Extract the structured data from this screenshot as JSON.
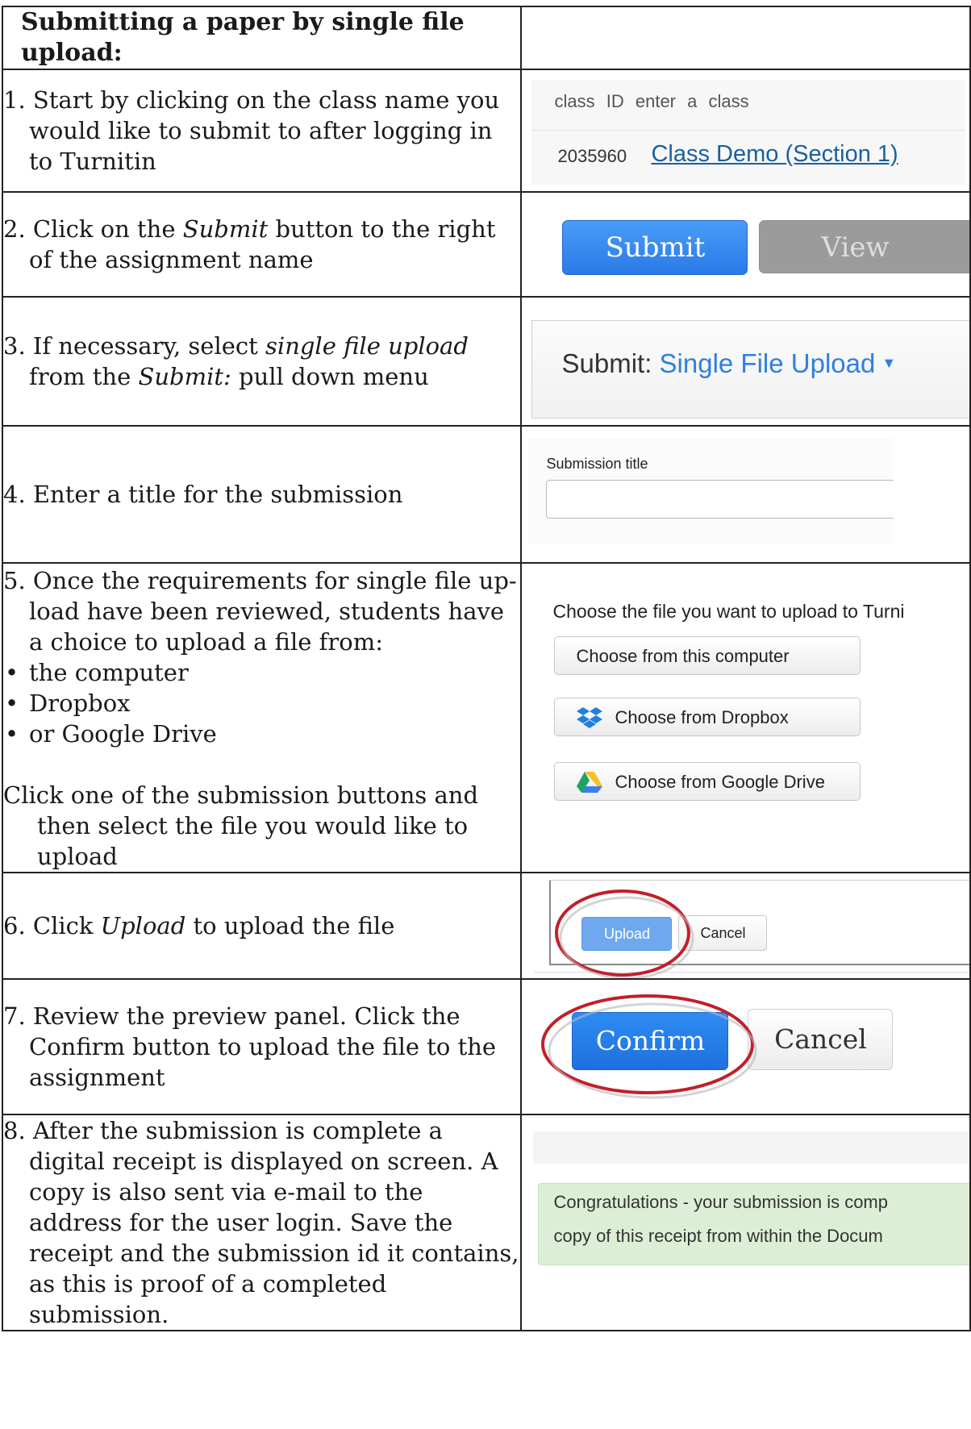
{
  "header": {
    "title": "Submitting a paper by single file upload:"
  },
  "steps": [
    {
      "num": "1.",
      "text": "Start by clicking on the class name you would like to submit to after logging in to Turnitin"
    },
    {
      "num": "2.",
      "pre": "Click on the ",
      "em": "Submit",
      "post": " button to the right of the assignment name"
    },
    {
      "num": "3.",
      "pre": "If necessary, select ",
      "em1": "single file upload",
      "mid": " from the ",
      "em2": "Submit:",
      "post": " pull down menu"
    },
    {
      "num": "4.",
      "text": "Enter a title for the submission"
    },
    {
      "num": "5.",
      "text": "Once the requirements for single file up-load have been reviewed, students have a choice to upload a file from:",
      "options": [
        "the computer",
        "Dropbox",
        "or Google Drive"
      ],
      "followup": "Click one of the submission buttons and then select the file you would like to upload"
    },
    {
      "num": "6.",
      "pre": "Click ",
      "em": "Upload",
      "post": " to upload the file"
    },
    {
      "num": "7.",
      "text": "Review the preview panel. Click the Confirm button to upload the file to the assignment"
    },
    {
      "num": "8.",
      "text": "After the submission is complete a digital receipt is displayed on screen. A copy is also sent via e-mail to the address for the user login. Save the receipt and the submission id it contains, as this is proof of a completed submission."
    }
  ],
  "screens": {
    "class_list": {
      "col_id": "class ID",
      "col_name": "enter a class",
      "class_id": "2035960",
      "class_name": "Class Demo (Section 1)"
    },
    "assignment": {
      "submit_label": "Submit",
      "view_label": "View"
    },
    "submit_menu": {
      "label": "Submit:",
      "value": "Single File Upload"
    },
    "title_field": {
      "label": "Submission title",
      "value": ""
    },
    "file_choice": {
      "intro": "Choose the file you want to upload to Turni",
      "computer_label": "Choose from this computer",
      "dropbox_label": "Choose from Dropbox",
      "gdrive_label": "Choose from Google Drive"
    },
    "upload": {
      "upload_label": "Upload",
      "cancel_label": "Cancel"
    },
    "confirm": {
      "confirm_label": "Confirm",
      "cancel_label": "Cancel"
    },
    "receipt": {
      "line1": "Congratulations - your submission is comp",
      "line2": "copy of this receipt from within the Docum"
    }
  },
  "colors": {
    "link": "#1a5f9e",
    "submit_blue": "#2a7ae8",
    "highlight_ring": "#c0202a",
    "receipt_green": "#dcefd6"
  }
}
